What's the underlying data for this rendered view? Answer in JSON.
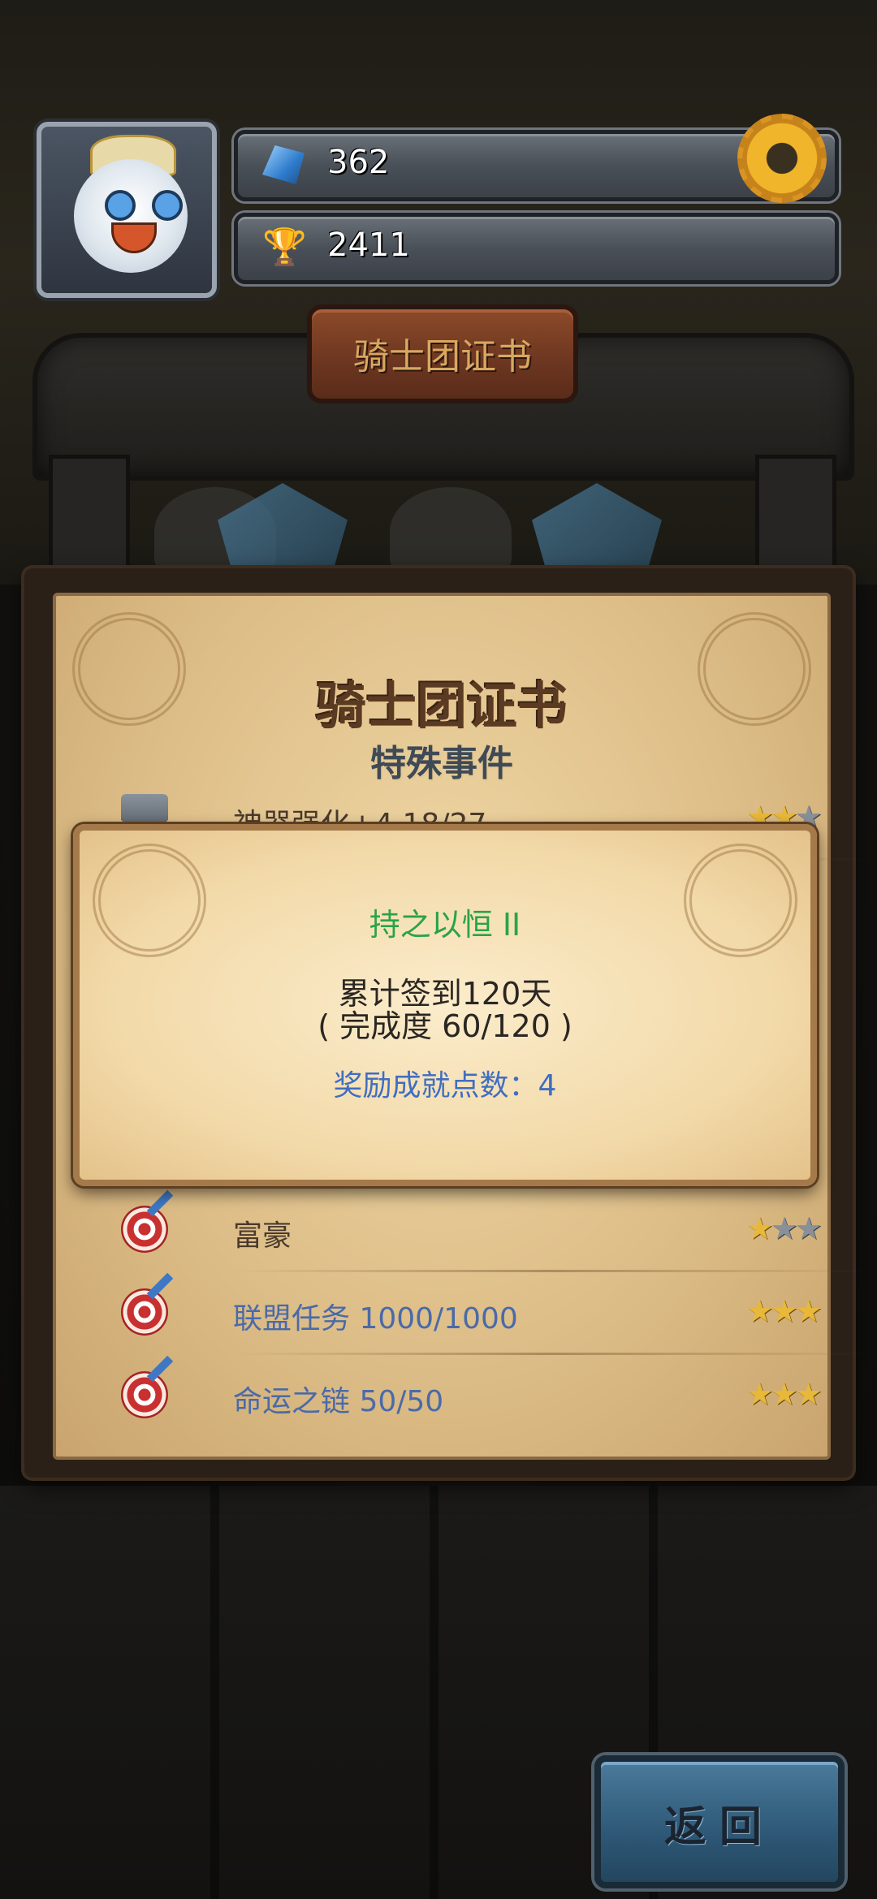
{
  "header": {
    "gems": "362",
    "trophies": "2411",
    "gem_icon": "blue-gem-icon",
    "trophy_icon": "trophy-icon",
    "settings_icon": "gear-icon"
  },
  "sign": {
    "title": "骑士团证书"
  },
  "panel": {
    "title": "骑士团证书",
    "subtitle": "特殊事件",
    "rows": [
      {
        "label": "神器强化+4 18/27",
        "icon": "shield-icon",
        "stars_earned": 2,
        "stars_total": 3,
        "stars": "★★★"
      },
      {
        "label": "富豪",
        "icon": "target-icon",
        "stars_earned": 1,
        "stars_total": 3,
        "stars": "★★★"
      },
      {
        "label": "联盟任务 1000/1000",
        "icon": "target-icon",
        "stars_earned": 3,
        "stars_total": 3,
        "stars": "★★★"
      },
      {
        "label": "命运之链 50/50",
        "icon": "target-icon",
        "stars_earned": 3,
        "stars_total": 3,
        "stars": "★★★"
      }
    ]
  },
  "tooltip": {
    "name": "持之以恒 II",
    "description": "累计签到120天",
    "progress": "( 完成度 60/120 )",
    "reward": "奖励成就点数：4"
  },
  "back_button": {
    "label": "返回"
  },
  "colors": {
    "achievement_name": "#2aa348",
    "reward_text": "#3f6ec2",
    "star_gold": "#e8b83a",
    "star_grey": "#8a9098"
  }
}
